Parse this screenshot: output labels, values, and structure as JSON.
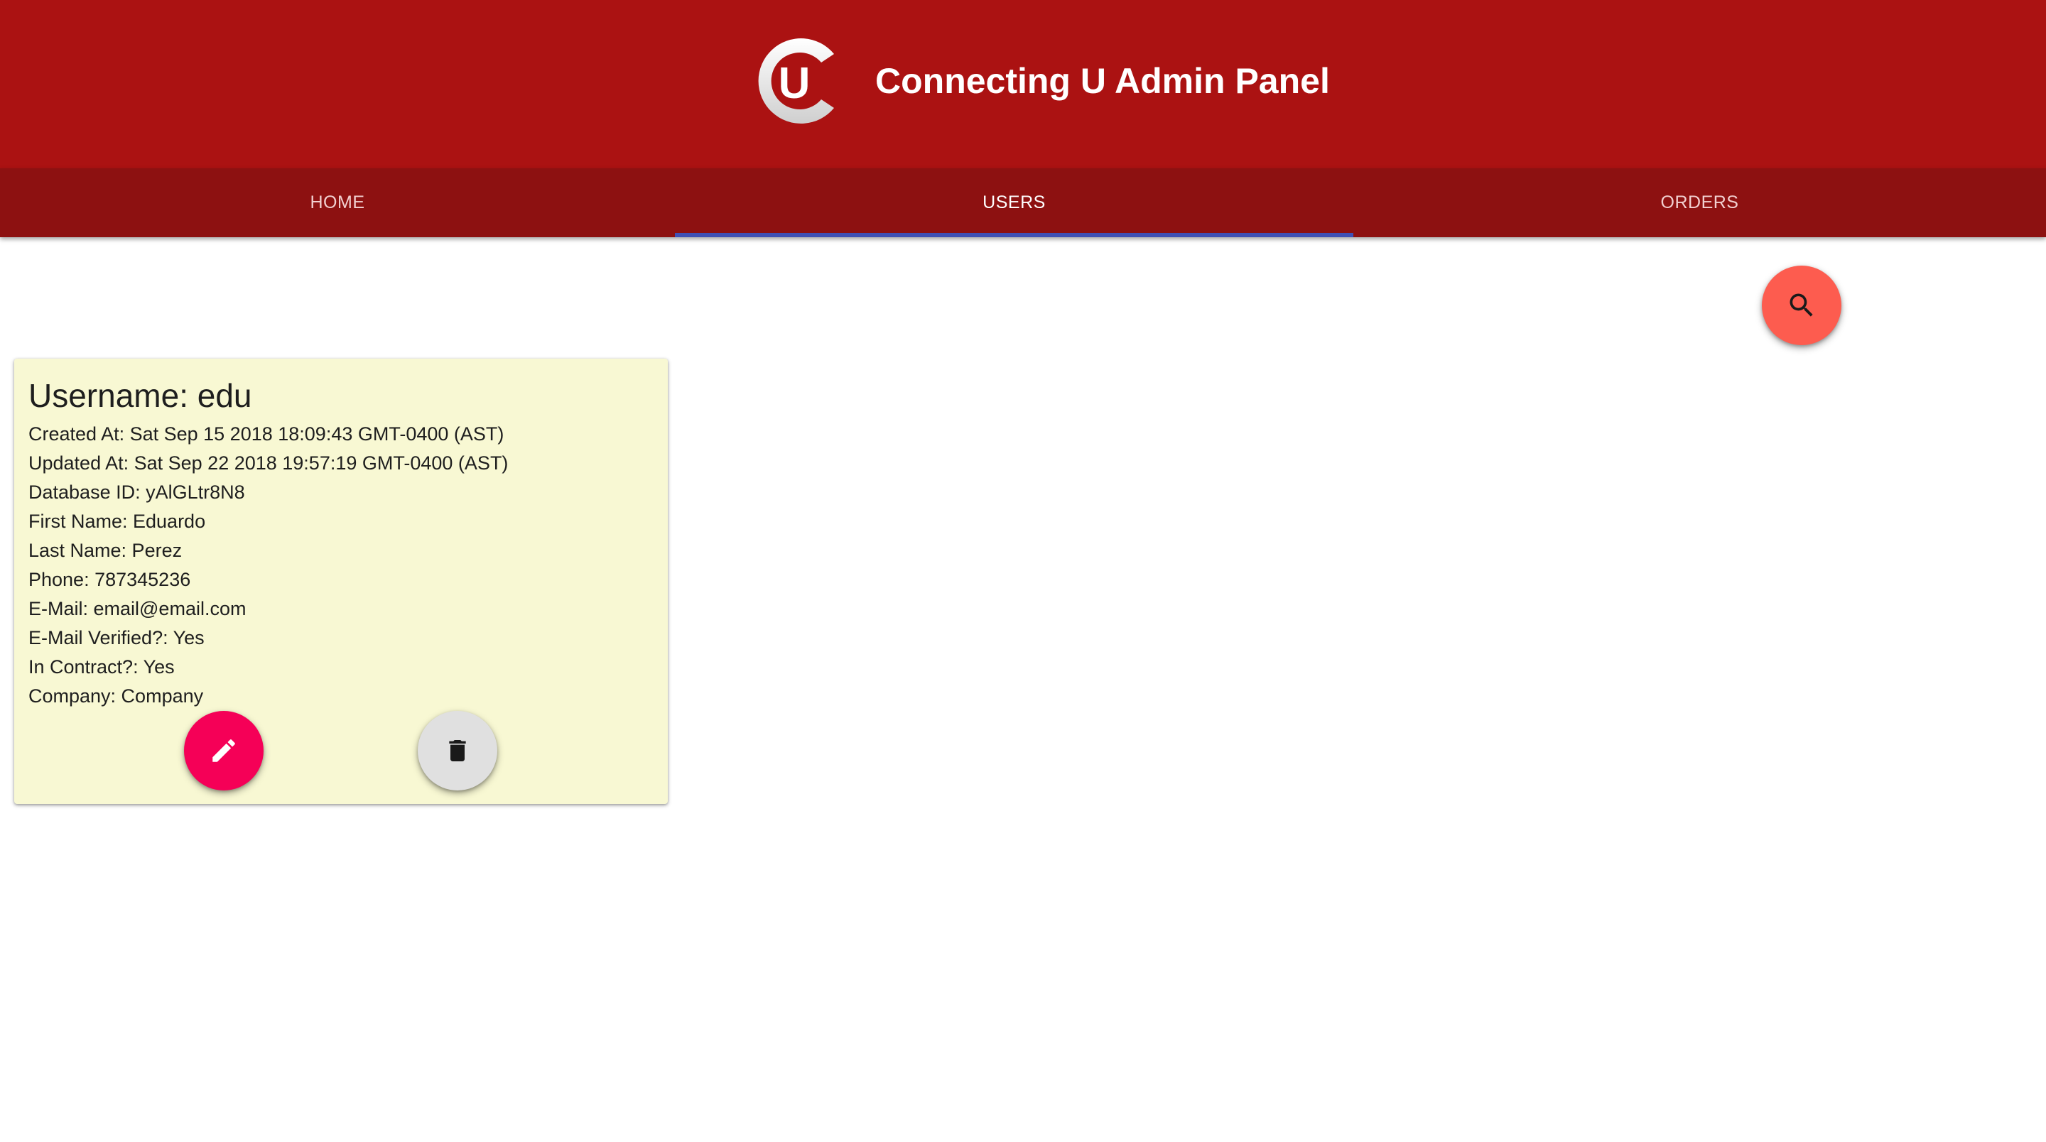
{
  "header": {
    "title": "Connecting U Admin Panel",
    "logo_letter": "U",
    "background_color": "#ab1212"
  },
  "tabs": [
    {
      "label": "HOME",
      "active": false
    },
    {
      "label": "USERS",
      "active": true
    },
    {
      "label": "ORDERS",
      "active": false
    }
  ],
  "tab_indicator_color": "#3f51b5",
  "search_button": {
    "icon": "search-icon",
    "color": "#fd5c4f"
  },
  "user_card": {
    "title": "Username: edu",
    "fields": [
      "Created At: Sat Sep 15 2018 18:09:43 GMT-0400 (AST)",
      "Updated At: Sat Sep 22 2018 19:57:19 GMT-0400 (AST)",
      "Database ID: yAlGLtr8N8",
      "First Name: Eduardo",
      "Last Name: Perez",
      "Phone: 787345236",
      "E-Mail: email@email.com",
      "E-Mail Verified?: Yes",
      "In Contract?: Yes",
      "Company: Company"
    ],
    "background_color": "#f8f8d3",
    "edit_button": {
      "icon": "pencil-icon",
      "color": "#f50057"
    },
    "delete_button": {
      "icon": "trash-icon",
      "color": "#e0e0e0"
    }
  }
}
